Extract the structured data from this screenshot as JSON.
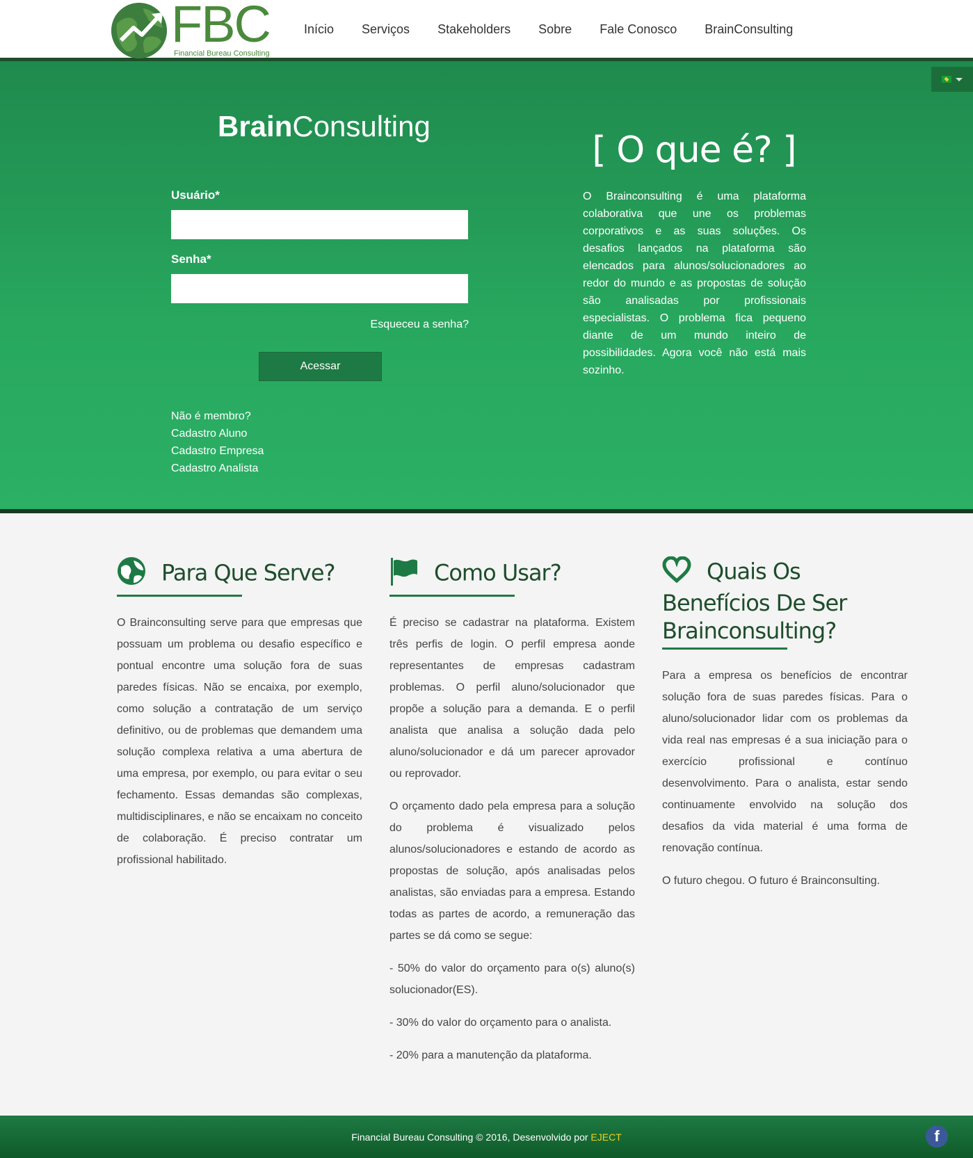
{
  "header": {
    "logo_text": "FBC",
    "logo_subtitle": "Financial Bureau Consulting",
    "nav": [
      "Início",
      "Serviços",
      "Stakeholders",
      "Sobre",
      "Fale Conosco",
      "BrainConsulting"
    ]
  },
  "hero": {
    "title_bold": "Brain",
    "title_light": "Consulting",
    "usuario_label": "Usuário*",
    "senha_label": "Senha*",
    "forgot": "Esqueceu a senha?",
    "submit": "Acessar",
    "not_member": "Não é membro?",
    "cadastro_aluno": "Cadastro Aluno",
    "cadastro_empresa": "Cadastro Empresa",
    "cadastro_analista": "Cadastro Analista",
    "oque_title": "[ O que é? ]",
    "oque_text": "O Brainconsulting é uma plataforma colaborativa que une os problemas corporativos e as suas soluções. Os desafios lançados na plataforma são elencados para alunos/solucionadores ao redor do mundo e as propostas de solução são analisadas por profissionais especialistas. O problema fica pequeno diante de um mundo inteiro de possibilidades. Agora você não está mais sozinho."
  },
  "sections": {
    "para_que": {
      "title": "Para Que Serve?",
      "text": "O Brainconsulting serve para que empresas que possuam um problema ou desafio específico e pontual encontre uma solução fora de suas paredes físicas. Não se encaixa, por exemplo, como solução a contratação de um serviço definitivo, ou de problemas que demandem uma solução complexa relativa a uma abertura de uma empresa, por exemplo, ou para evitar o seu fechamento. Essas demandas são complexas, multidisciplinares, e não se encaixam no conceito de colaboração. É preciso contratar um profissional habilitado."
    },
    "como_usar": {
      "title": "Como Usar?",
      "p1": "É preciso se cadastrar na plataforma. Existem três perfis de login. O perfil empresa aonde representantes de empresas cadastram problemas. O perfil aluno/solucionador que propõe a solução para a demanda. E o perfil analista que analisa a solução dada pelo aluno/solucionador e dá um parecer aprovador ou reprovador.",
      "p2": "O orçamento dado pela empresa para a solução do problema é visualizado pelos alunos/solucionadores e estando de acordo as propostas de solução, após analisadas pelos analistas, são enviadas para a empresa. Estando todas as partes de acordo, a remuneração das partes se dá como se segue:",
      "p3": "- 50% do valor do orçamento para o(s) aluno(s) solucionador(ES).",
      "p4": "- 30% do valor do orçamento para o analista.",
      "p5": "- 20% para a manutenção da plataforma."
    },
    "beneficios": {
      "title": "Quais Os Benefícios De Ser Brainconsulting?",
      "p1": "Para a empresa os benefícios de encontrar solução fora de suas paredes físicas. Para o aluno/solucionador lidar com os problemas da vida real nas empresas é a sua iniciação para o exercício profissional e contínuo desenvolvimento. Para o analista, estar sendo continuamente envolvido na solução dos desafios da vida material é uma forma de renovação contínua.",
      "p2": "O futuro chegou. O futuro é Brainconsulting."
    }
  },
  "footer": {
    "text": "Financial Bureau Consulting © 2016, Desenvolvido por ",
    "link": "EJECT",
    "facebook": "f"
  },
  "colors": {
    "green_dark": "#1e4d2b",
    "green_hero": "#28a85f",
    "accent": "#1e7a44"
  }
}
